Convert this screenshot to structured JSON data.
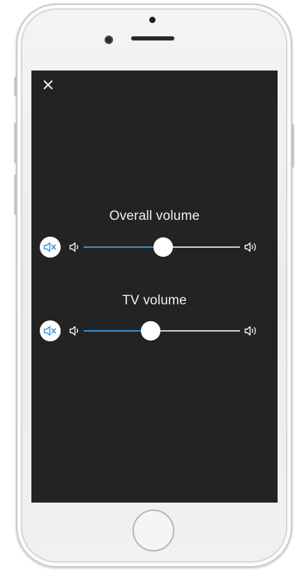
{
  "dialog": {
    "close_label": "close"
  },
  "overall": {
    "label": "Overall volume",
    "level": 0.51
  },
  "tv": {
    "label": "TV volume",
    "level": 0.43
  },
  "colors": {
    "screen_background": "#232323",
    "slider_fill": "#3a93d6",
    "slider_track": "#d6d6d6",
    "mute_icon": "#3a93d6"
  },
  "icons": {
    "close": "close-icon",
    "mute": "speaker-muted-icon",
    "volume_low": "speaker-low-icon",
    "volume_high": "speaker-high-icon"
  }
}
